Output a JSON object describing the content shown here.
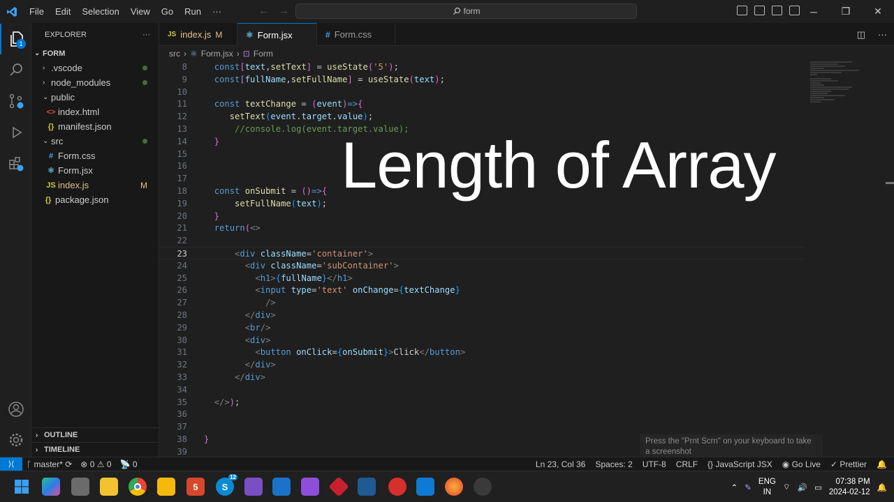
{
  "titlebar": {
    "menu": [
      "File",
      "Edit",
      "Selection",
      "View",
      "Go",
      "Run",
      "···"
    ],
    "search_text": "form"
  },
  "activity": {
    "explorer_badge": "1"
  },
  "sidebar": {
    "header": "EXPLORER",
    "folder": "FORM",
    "items": [
      {
        "label": ".vscode",
        "type": "folder-closed",
        "depth": 1,
        "decor": "dot"
      },
      {
        "label": "node_modules",
        "type": "folder-closed",
        "depth": 1,
        "decor": "dot"
      },
      {
        "label": "public",
        "type": "folder-open",
        "depth": 1,
        "decor": ""
      },
      {
        "label": "index.html",
        "type": "html",
        "depth": 2,
        "decor": ""
      },
      {
        "label": "manifest.json",
        "type": "json",
        "depth": 2,
        "decor": ""
      },
      {
        "label": "src",
        "type": "folder-open",
        "depth": 1,
        "decor": "dot"
      },
      {
        "label": "Form.css",
        "type": "css",
        "depth": 2,
        "decor": ""
      },
      {
        "label": "Form.jsx",
        "type": "jsx",
        "depth": 2,
        "decor": ""
      },
      {
        "label": "index.js",
        "type": "js",
        "depth": 2,
        "decor": "M"
      },
      {
        "label": "package.json",
        "type": "json",
        "depth": 1,
        "decor": ""
      }
    ],
    "outline": "OUTLINE",
    "timeline": "TIMELINE"
  },
  "tabs": [
    {
      "icon": "JS",
      "label": "index.js",
      "mark": "M"
    },
    {
      "icon": "⚛",
      "label": "Form.jsx",
      "mark": "●"
    },
    {
      "icon": "#",
      "label": "Form.css",
      "mark": ""
    }
  ],
  "breadcrumb": [
    "src",
    "Form.jsx",
    "Form"
  ],
  "code": {
    "lines": [
      {
        "n": "8"
      },
      {
        "n": "9"
      },
      {
        "n": "10"
      },
      {
        "n": "11"
      },
      {
        "n": "12"
      },
      {
        "n": "13"
      },
      {
        "n": "14"
      },
      {
        "n": "15"
      },
      {
        "n": "16"
      },
      {
        "n": "17"
      },
      {
        "n": "18"
      },
      {
        "n": "19"
      },
      {
        "n": "20"
      },
      {
        "n": "21"
      },
      {
        "n": "22"
      },
      {
        "n": "23"
      },
      {
        "n": "24"
      },
      {
        "n": "25"
      },
      {
        "n": "26"
      },
      {
        "n": "27"
      },
      {
        "n": "28"
      },
      {
        "n": "29"
      },
      {
        "n": "30"
      },
      {
        "n": "31"
      },
      {
        "n": "32"
      },
      {
        "n": "33"
      },
      {
        "n": "34"
      },
      {
        "n": "35"
      },
      {
        "n": "36"
      },
      {
        "n": "37"
      },
      {
        "n": "38"
      },
      {
        "n": "39"
      }
    ],
    "current_line": "23"
  },
  "overlay": "Length of Array",
  "notice": "Press the \"Prnt Scrn\" on your keyboard to take a screenshot",
  "status": {
    "branch": "master*",
    "errors": "0",
    "warnings": "0",
    "ports": "0",
    "position": "Ln 23, Col 36",
    "spaces": "Spaces: 2",
    "encoding": "UTF-8",
    "eol": "CRLF",
    "language": "JavaScript JSX",
    "golive": "Go Live",
    "prettier": "Prettier"
  },
  "taskbar": {
    "lang1": "ENG",
    "lang2": "IN",
    "time": "07:38 PM",
    "date": "2024-02-12",
    "skype_badge": "12"
  }
}
